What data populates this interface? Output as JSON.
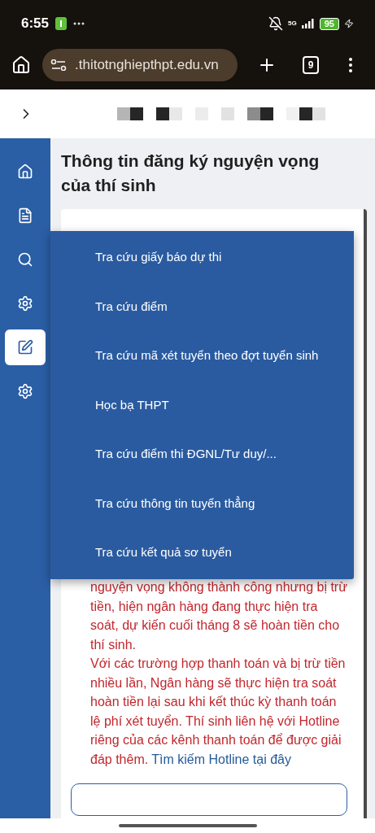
{
  "status_bar": {
    "time": "6:55",
    "network": "5G",
    "battery": "95"
  },
  "browser": {
    "url": ".thitotnghiepthpt.edu.vn",
    "tab_count": "9"
  },
  "heading": "Thông tin đăng ký nguyện vọng của thí sinh",
  "sidebar": {
    "items": [
      {
        "kind": "home",
        "selected": false
      },
      {
        "kind": "document",
        "selected": false
      },
      {
        "kind": "search",
        "selected": false
      },
      {
        "kind": "gear",
        "selected": false
      },
      {
        "kind": "edit",
        "selected": true
      },
      {
        "kind": "gear",
        "selected": false
      }
    ]
  },
  "menu": {
    "items": [
      "Tra cứu giấy báo dự thi",
      "Tra cứu điểm",
      "Tra cứu mã xét tuyển theo đợt tuyển sinh",
      "Học bạ THPT",
      "Tra cứu điểm thi ĐGNL/Tư duy/...",
      "Tra cứu thông tin tuyển thẳng",
      "Tra cứu kết quả sơ tuyển"
    ]
  },
  "notice": {
    "text": "nguyện vọng không thành công nhưng bị trừ tiền, hiện ngân hàng đang thực hiện tra soát, dự kiến cuối tháng 8 sẽ hoàn tiền cho thí sinh.",
    "text_2": "Với các trường hợp thanh toán và bị trừ tiền nhiều lần, Ngân hàng sẽ thực hiện tra soát hoàn tiền lại sau khi kết thúc kỳ thanh toán lệ phí xét tuyển. Thí sinh liên hệ với Hotline riêng của các kênh thanh toán để được giải đáp thêm.",
    "link": "Tìm kiếm Hotline tại đây"
  }
}
